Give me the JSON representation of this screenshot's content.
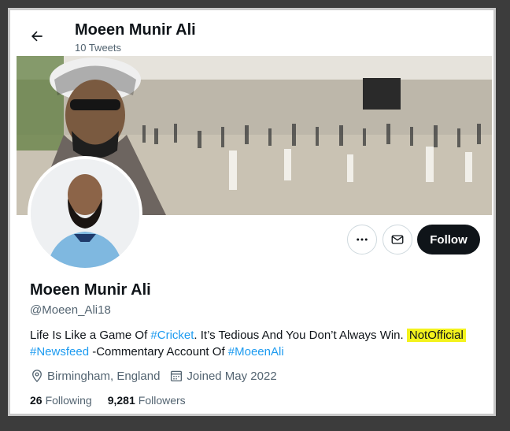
{
  "header": {
    "title": "Moeen Munir Ali",
    "tweet_count": "10 Tweets"
  },
  "profile": {
    "name": "Moeen Munir Ali",
    "handle": "@Moeen_Ali18",
    "bio": {
      "part1": "Life Is Like a Game Of ",
      "tag1": "#Cricket",
      "part2": ". It’s Tedious And You Don’t Always Win. ",
      "highlight": "NotOfficial",
      "tag2": "#Newsfeed",
      "part3": " -Commentary Account Of ",
      "tag3": "#MoeenAli"
    },
    "location": "Birmingham, England",
    "joined": "Joined May 2022",
    "following_count": "26",
    "following_label": "Following",
    "followers_count": "9,281",
    "followers_label": "Followers"
  },
  "actions": {
    "follow_label": "Follow"
  },
  "colors": {
    "link": "#1d9bf0",
    "highlight": "#f3f21d",
    "follow_bg": "#0f1419"
  },
  "icons": {
    "back": "arrow-left-icon",
    "more": "more-dots-icon",
    "message": "envelope-icon",
    "location": "location-pin-icon",
    "calendar": "calendar-icon"
  }
}
